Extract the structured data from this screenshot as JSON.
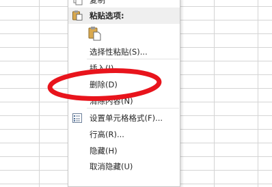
{
  "menu": {
    "top_item_label": "复制",
    "paste_header": "粘贴选项:",
    "paste_special": "选择性粘贴(S)...",
    "insert": "插入(I)",
    "delete": "删除(D)",
    "clear_contents": "清除内容(N)",
    "format_cells": "设置单元格格式(F)...",
    "row_height": "行高(R)...",
    "hide": "隐藏(H)",
    "unhide": "取消隐藏(U)"
  },
  "annotation": {
    "color": "#e8141c"
  },
  "icons": {
    "paste_header_icon": "clipboard-icon",
    "paste_option_icon": "paste-clipboard-icon",
    "format_cells_icon": "format-cells-icon"
  }
}
